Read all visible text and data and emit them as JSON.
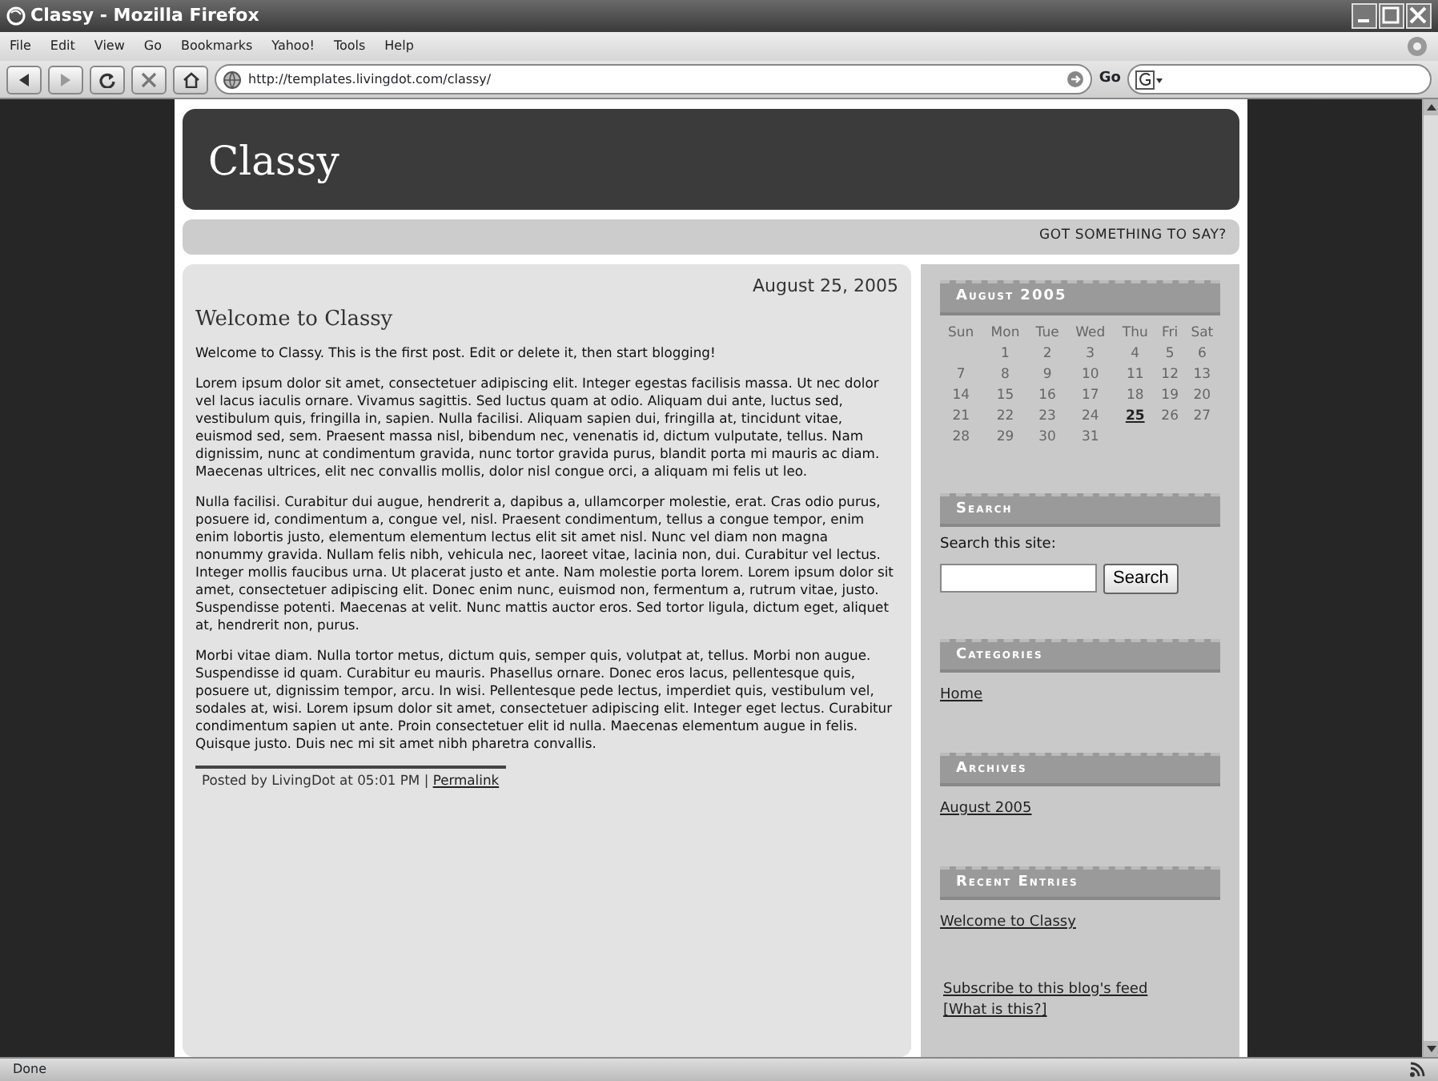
{
  "window": {
    "title": "Classy - Mozilla Firefox"
  },
  "menu": [
    "File",
    "Edit",
    "View",
    "Go",
    "Bookmarks",
    "Yahoo!",
    "Tools",
    "Help"
  ],
  "toolbar": {
    "url": "http://templates.livingdot.com/classy/",
    "go_label": "Go"
  },
  "blog": {
    "title": "Classy",
    "tagline": "GOT SOMETHING TO SAY?"
  },
  "post": {
    "date": "August 25, 2005",
    "title": "Welcome to Classy",
    "paragraphs": [
      "Welcome to Classy. This is the first post. Edit or delete it, then start blogging!",
      "Lorem ipsum dolor sit amet, consectetuer adipiscing elit. Integer egestas facilisis massa. Ut nec dolor vel lacus iaculis ornare. Vivamus sagittis. Sed luctus quam at odio. Aliquam dui ante, luctus sed, vestibulum quis, fringilla in, sapien. Nulla facilisi. Aliquam sapien dui, fringilla at, tincidunt vitae, euismod sed, sem. Praesent massa nisl, bibendum nec, venenatis id, dictum vulputate, tellus. Nam dignissim, nunc at condimentum gravida, nunc tortor gravida purus, blandit porta mi mauris ac diam. Maecenas ultrices, elit nec convallis mollis, dolor nisl congue orci, a aliquam mi felis ut leo.",
      "Nulla facilisi. Curabitur dui augue, hendrerit a, dapibus a, ullamcorper molestie, erat. Cras odio purus, posuere id, condimentum a, congue vel, nisl. Praesent condimentum, tellus a congue tempor, enim enim lobortis justo, elementum elementum lectus elit sit amet nisl. Nunc vel diam non magna nonummy gravida. Nullam felis nibh, vehicula nec, laoreet vitae, lacinia non, dui. Curabitur vel lectus. Integer mollis faucibus urna. Ut placerat justo et ante. Nam molestie porta lorem. Lorem ipsum dolor sit amet, consectetuer adipiscing elit. Donec enim nunc, euismod non, fermentum a, rutrum vitae, justo. Suspendisse potenti. Maecenas at velit. Nunc mattis auctor eros. Sed tortor ligula, dictum eget, aliquet at, hendrerit non, purus.",
      "Morbi vitae diam. Nulla tortor metus, dictum quis, semper quis, volutpat at, tellus. Morbi non augue. Suspendisse id quam. Curabitur eu mauris. Phasellus ornare. Donec eros lacus, pellentesque quis, posuere ut, dignissim tempor, arcu. In wisi. Pellentesque pede lectus, imperdiet quis, vestibulum vel, sodales at, wisi. Lorem ipsum dolor sit amet, consectetuer adipiscing elit. Integer eget lectus. Curabitur condimentum sapien ut ante. Proin consectetuer elit id nulla. Maecenas elementum augue in felis. Quisque justo. Duis nec mi sit amet nibh pharetra convallis."
    ],
    "footer": {
      "text": "Posted by LivingDot at 05:01 PM |",
      "link": "Permalink"
    }
  },
  "sidebar": {
    "calendar": {
      "heading": "August 2005",
      "weekdays": [
        "Sun",
        "Mon",
        "Tue",
        "Wed",
        "Thu",
        "Fri",
        "Sat"
      ],
      "weeks": [
        {
          "fill_from_end": true,
          "days": [
            {
              "day": "1",
              "linked": false
            },
            {
              "day": "2",
              "linked": false
            },
            {
              "day": "3",
              "linked": false
            },
            {
              "day": "4",
              "linked": false
            },
            {
              "day": "5",
              "linked": false
            },
            {
              "day": "6",
              "linked": false
            }
          ]
        },
        {
          "days": [
            {
              "day": "7",
              "linked": false
            },
            {
              "day": "8",
              "linked": false
            },
            {
              "day": "9",
              "linked": false
            },
            {
              "day": "10",
              "linked": false
            },
            {
              "day": "11",
              "linked": false
            },
            {
              "day": "12",
              "linked": false
            },
            {
              "day": "13",
              "linked": false
            }
          ]
        },
        {
          "days": [
            {
              "day": "14",
              "linked": false
            },
            {
              "day": "15",
              "linked": false
            },
            {
              "day": "16",
              "linked": false
            },
            {
              "day": "17",
              "linked": false
            },
            {
              "day": "18",
              "linked": false
            },
            {
              "day": "19",
              "linked": false
            },
            {
              "day": "20",
              "linked": false
            }
          ]
        },
        {
          "days": [
            {
              "day": "21",
              "linked": false
            },
            {
              "day": "22",
              "linked": false
            },
            {
              "day": "23",
              "linked": false
            },
            {
              "day": "24",
              "linked": false
            },
            {
              "day": "25",
              "linked": true
            },
            {
              "day": "26",
              "linked": false
            },
            {
              "day": "27",
              "linked": false
            }
          ]
        },
        {
          "fill_from_end": false,
          "days": [
            {
              "day": "28",
              "linked": false
            },
            {
              "day": "29",
              "linked": false
            },
            {
              "day": "30",
              "linked": false
            },
            {
              "day": "31",
              "linked": false
            }
          ]
        }
      ]
    },
    "search": {
      "heading": "Search",
      "label": "Search this site:",
      "button": "Search"
    },
    "sections": [
      {
        "heading": "Categories",
        "links": [
          "Home"
        ]
      },
      {
        "heading": "Archives",
        "links": [
          "August 2005"
        ]
      },
      {
        "heading": "Recent Entries",
        "links": [
          "Welcome to Classy"
        ]
      }
    ],
    "feed": {
      "link": "Subscribe to this blog's feed",
      "help": "[What is this?]"
    }
  },
  "status_bar": {
    "text": "Done"
  }
}
